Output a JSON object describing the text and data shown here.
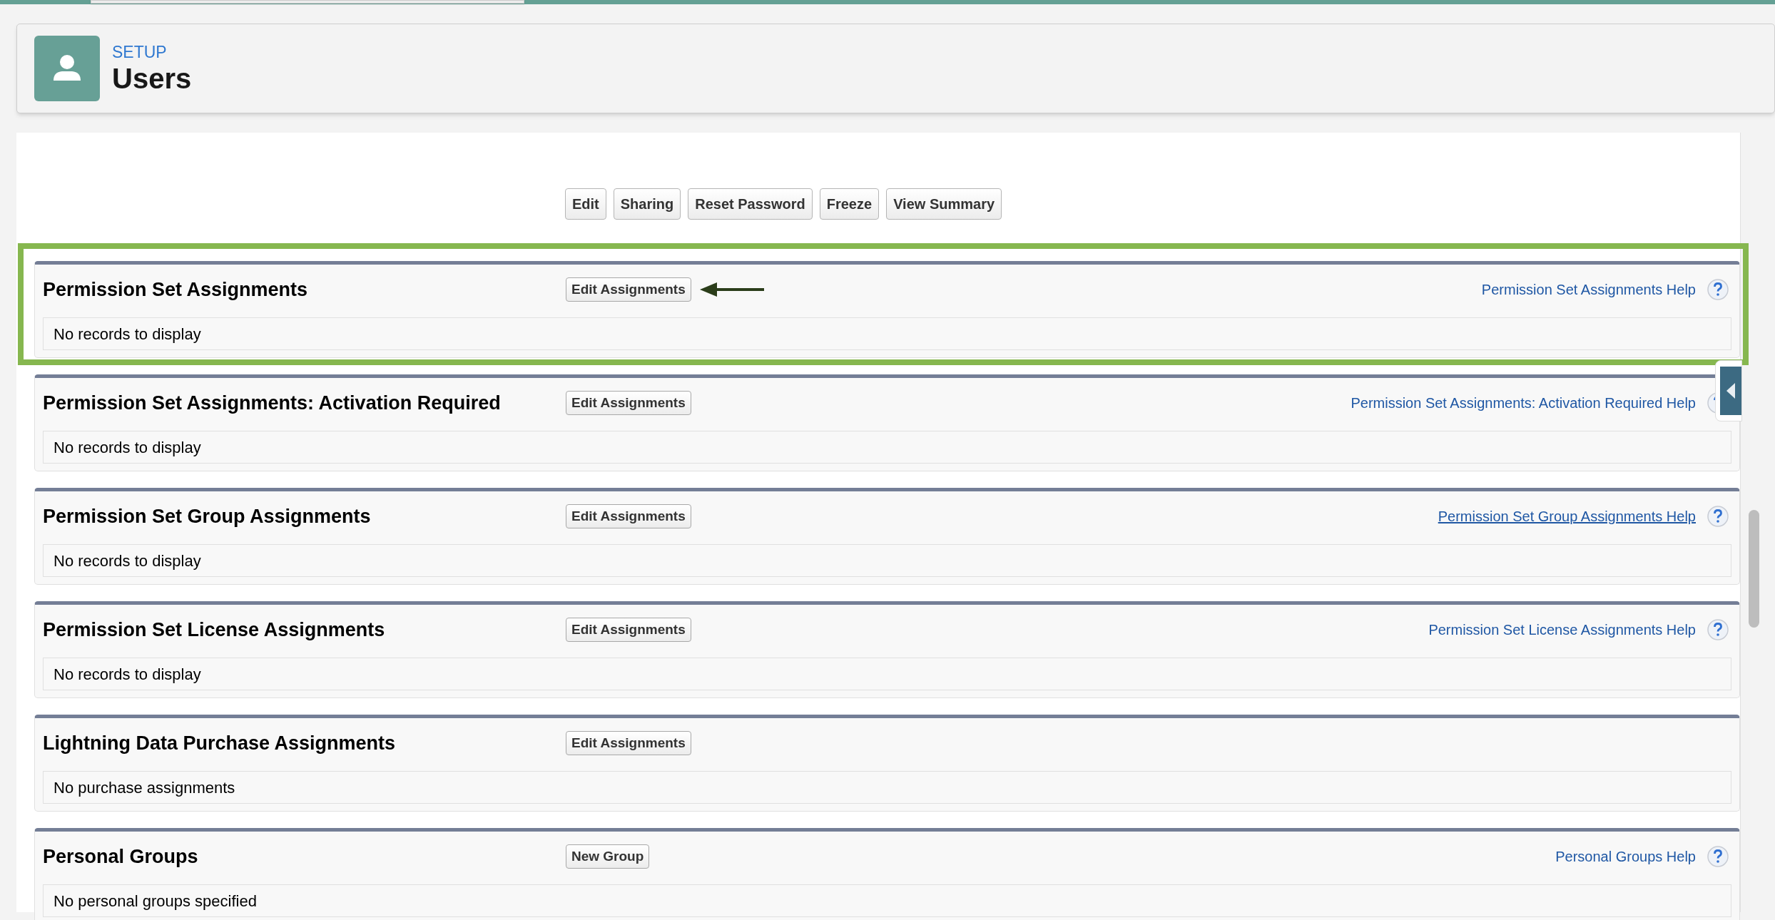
{
  "header": {
    "eyebrow": "SETUP",
    "title": "Users"
  },
  "actions": [
    "Edit",
    "Sharing",
    "Reset Password",
    "Freeze",
    "View Summary"
  ],
  "sections": [
    {
      "title": "Permission Set Assignments",
      "button": "Edit Assignments",
      "help": "Permission Set Assignments Help",
      "help_hovered": false,
      "message": "No records to display",
      "highlighted": true,
      "arrow": true
    },
    {
      "title": "Permission Set Assignments: Activation Required",
      "button": "Edit Assignments",
      "help": "Permission Set Assignments: Activation Required Help",
      "help_hovered": false,
      "message": "No records to display",
      "highlighted": false,
      "arrow": false
    },
    {
      "title": "Permission Set Group Assignments",
      "button": "Edit Assignments",
      "help": "Permission Set Group Assignments Help",
      "help_hovered": true,
      "message": "No records to display",
      "highlighted": false,
      "arrow": false
    },
    {
      "title": "Permission Set License Assignments",
      "button": "Edit Assignments",
      "help": "Permission Set License Assignments Help",
      "help_hovered": false,
      "message": "No records to display",
      "highlighted": false,
      "arrow": false
    },
    {
      "title": "Lightning Data Purchase Assignments",
      "button": "Edit Assignments",
      "message": "No purchase assignments",
      "highlighted": false,
      "arrow": false
    },
    {
      "title": "Personal Groups",
      "button": "New Group",
      "help": "Personal Groups Help",
      "help_hovered": false,
      "message": "No personal groups specified",
      "highlighted": false,
      "arrow": false
    }
  ]
}
